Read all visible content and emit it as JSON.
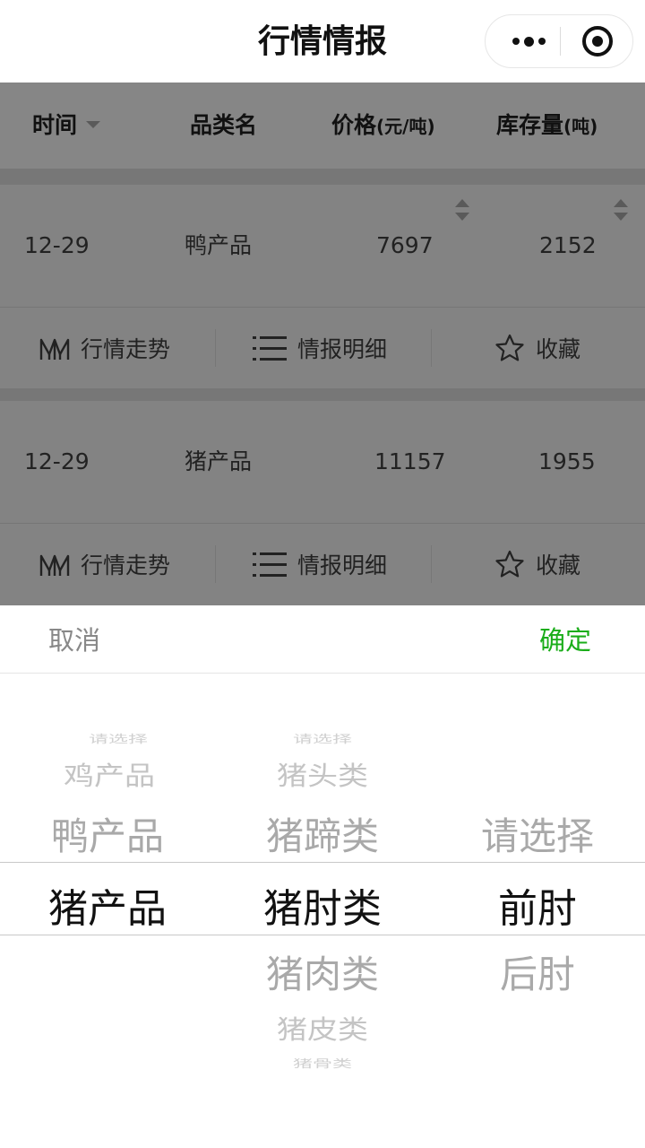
{
  "navbar": {
    "title": "行情情报",
    "more_icon": "more-dots-icon",
    "close_icon": "target-icon"
  },
  "table": {
    "headers": {
      "time": "时间",
      "category": "品类名",
      "price": "价格",
      "price_unit": "(元/吨)",
      "stock": "库存量",
      "stock_unit": "(吨)"
    },
    "rows": [
      {
        "date": "12-29",
        "category": "鸭产品",
        "price": "7697",
        "stock": "2152"
      },
      {
        "date": "12-29",
        "category": "猪产品",
        "price": "11157",
        "stock": "1955"
      }
    ],
    "actions": {
      "trend": "行情走势",
      "detail": "情报明细",
      "favorite": "收藏"
    }
  },
  "picker": {
    "cancel": "取消",
    "confirm": "确定",
    "confirm_color": "#1aad19",
    "col1": [
      "请选择",
      "鸡产品",
      "鸭产品",
      "猪产品"
    ],
    "col2": [
      "请选择",
      "猪头类",
      "猪蹄类",
      "猪肘类",
      "猪肉类",
      "猪皮类",
      "猪骨类"
    ],
    "col3": [
      "请选择",
      "前肘",
      "后肘"
    ]
  }
}
